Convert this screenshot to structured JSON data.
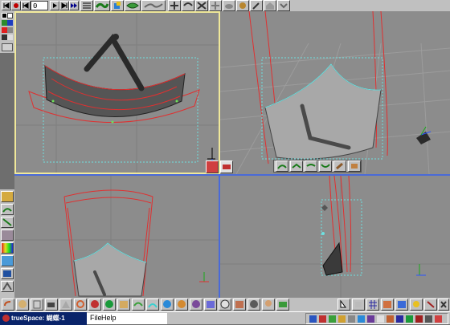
{
  "app": {
    "window_title": "trueSpace: 蝴蝶-1",
    "frame_value": "0"
  },
  "menu": {
    "file_label": "File",
    "help_label": "Help"
  },
  "colors": {
    "viewport_bg": "#8c8c8c",
    "toolbar_bg": "#c0c0c0",
    "active_viewport_border": "#f0e89a",
    "splitter": "#4a6ad8",
    "title_bar": "#0a246a",
    "spline_red": "#e03030",
    "bbox_cyan": "#6ee0e0"
  },
  "icons": {
    "palette_colors": [
      "#000000",
      "#ffffff",
      "#2e8b2e",
      "#e02020"
    ],
    "bottom_toolbar": [
      "sphere-icon",
      "cylinder-icon",
      "cone-icon",
      "torus-icon",
      "plane-icon",
      "deform-icon",
      "paint-icon",
      "material-icon",
      "light-icon",
      "camera-icon",
      "render-icon",
      "scene-icon",
      "animation-icon",
      "path-icon",
      "character-icon",
      "tree-icon",
      "texture-icon",
      "grid-icon"
    ]
  },
  "viewports": [
    {
      "name": "top-left",
      "active": true
    },
    {
      "name": "perspective",
      "active": false
    },
    {
      "name": "front",
      "active": false
    },
    {
      "name": "side",
      "active": false
    }
  ]
}
